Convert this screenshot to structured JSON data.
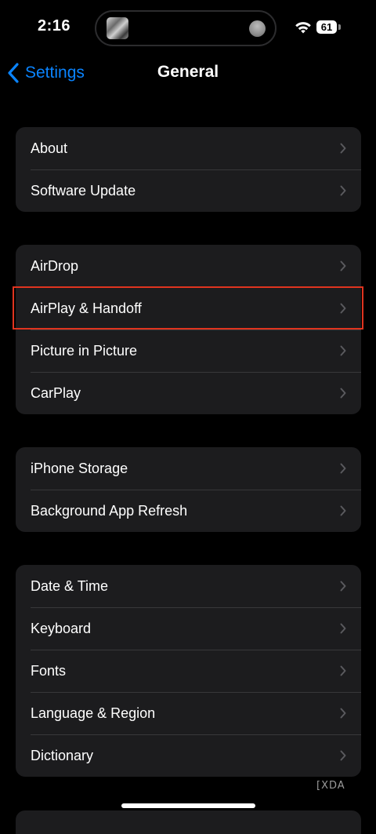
{
  "status_bar": {
    "time": "2:16",
    "battery": "61"
  },
  "nav": {
    "back_label": "Settings",
    "title": "General"
  },
  "groups": [
    {
      "rows": [
        {
          "label": "About"
        },
        {
          "label": "Software Update"
        }
      ]
    },
    {
      "rows": [
        {
          "label": "AirDrop"
        },
        {
          "label": "AirPlay & Handoff",
          "highlighted": true
        },
        {
          "label": "Picture in Picture"
        },
        {
          "label": "CarPlay"
        }
      ]
    },
    {
      "rows": [
        {
          "label": "iPhone Storage"
        },
        {
          "label": "Background App Refresh"
        }
      ]
    },
    {
      "rows": [
        {
          "label": "Date & Time"
        },
        {
          "label": "Keyboard"
        },
        {
          "label": "Fonts"
        },
        {
          "label": "Language & Region"
        },
        {
          "label": "Dictionary"
        }
      ]
    }
  ],
  "watermark": "XDA",
  "colors": {
    "background": "#000000",
    "cell": "#1c1c1e",
    "separator": "#38383a",
    "accent": "#0a84ff",
    "highlight": "#e0341f",
    "chevron": "#5a5a5e"
  },
  "icons": {
    "back": "chevron-left-icon",
    "row": "chevron-right-icon",
    "wifi": "wifi-icon",
    "battery": "battery-icon"
  }
}
